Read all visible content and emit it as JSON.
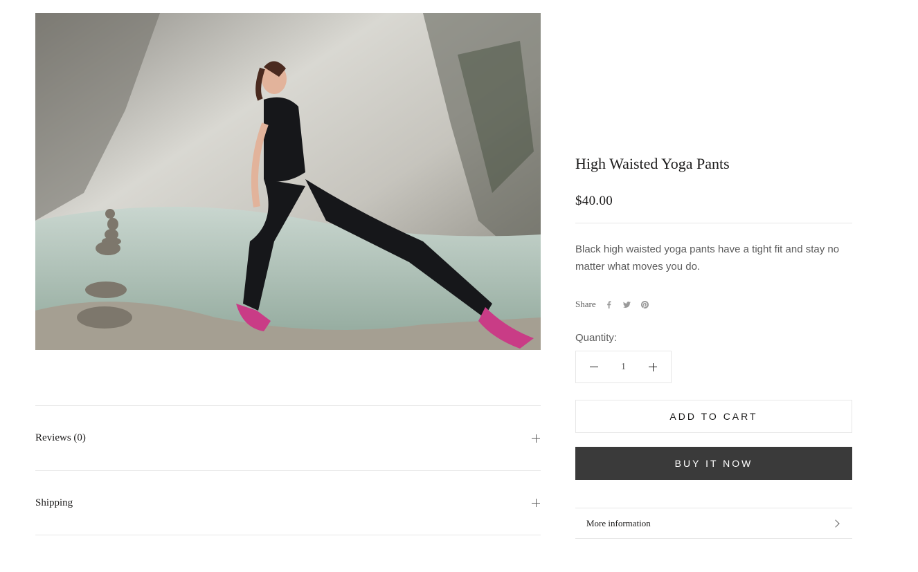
{
  "product": {
    "title": "High Waisted Yoga Pants",
    "price": "$40.00",
    "description": "Black high waisted yoga pants have a tight fit and stay no matter what moves you do.",
    "image_subject": "woman-in-black-yoga-outfit-lunging-by-river"
  },
  "share": {
    "label": "Share",
    "icons": [
      "facebook-icon",
      "twitter-icon",
      "pinterest-icon"
    ]
  },
  "quantity": {
    "label": "Quantity:",
    "value": "1"
  },
  "buttons": {
    "add_to_cart": "ADD TO CART",
    "buy_now": "BUY IT NOW"
  },
  "more_info": {
    "label": "More information"
  },
  "accordions": [
    {
      "label": "Reviews (0)"
    },
    {
      "label": "Shipping"
    }
  ],
  "colors": {
    "text": "#1c1b1b",
    "muted": "#5c5c5c",
    "border": "#e6e6e6",
    "buy_button": "#3a3a3a"
  }
}
